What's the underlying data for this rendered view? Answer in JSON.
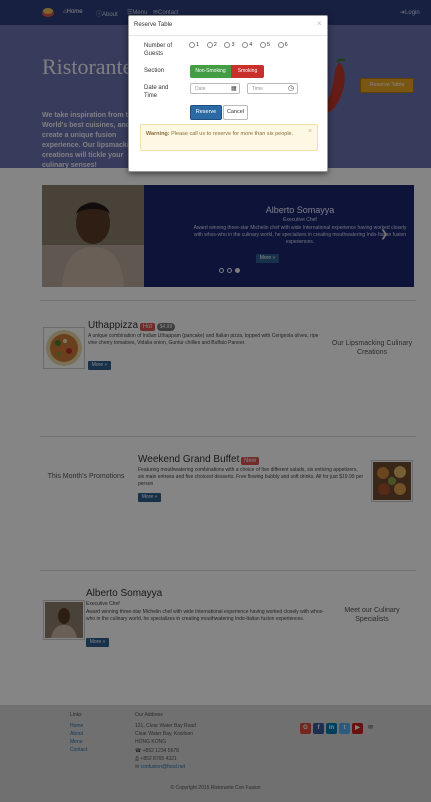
{
  "navbar": {
    "items": [
      {
        "label": "Home",
        "icon": "home-icon"
      },
      {
        "label": "About",
        "icon": "info-icon"
      },
      {
        "label": "Menu",
        "icon": "list-icon"
      },
      {
        "label": "Contact",
        "icon": "envelope-icon"
      }
    ],
    "login": "Login"
  },
  "jumbotron": {
    "title": "Ristorante Con Fusion",
    "description": "We take inspiration from the World's best cuisines, and create a unique fusion experience. Our lipsmacking creations will tickle your culinary senses!",
    "reserve_button": "Reserve Table"
  },
  "modal": {
    "title": "Reserve Table",
    "close": "×",
    "guests_label": "Number of Guests",
    "guest_options": [
      "1",
      "2",
      "3",
      "4",
      "5",
      "6"
    ],
    "section_label": "Section",
    "non_smoking": "Non-Smoking",
    "smoking": "Smoking",
    "datetime_label": "Date and Time",
    "date_placeholder": "Date",
    "time_placeholder": "Time",
    "reserve": "Reserve",
    "cancel": "Cancel",
    "warning_strong": "Warning:",
    "warning_text": "Please call us to reserve for more than six people.",
    "warning_close": "×"
  },
  "carousel": {
    "name": "Alberto Somayya",
    "role": "Executive Chef",
    "text": "Award winning three-star Michelin chef with wide International experience having worked closely with whos-who in the culinary world, he specializes in creating mouthwatering Indo-Italian fusion experiences.",
    "more": "More »"
  },
  "dish": {
    "name": "Uthappizza",
    "badge": "Hot",
    "price": "$4.99",
    "text": "A unique combination of Indian Uthappam (pancake) and Italian pizza, topped with Cerignola olives, ripe vine cherry tomatoes, Vidalia onion, Guntur chillies and Buffalo Paneer.",
    "more": "More »",
    "caption": "Our Lipsmacking Culinary Creations"
  },
  "promo": {
    "caption": "This Month's Promotions",
    "name": "Weekend Grand Buffet",
    "badge": "New",
    "text": "Featuring mouthwatering combinations with a choice of five different salads, six enticing appetizers, six main entrees and five choicest desserts. Free flowing bubbly and soft drinks. All for just $19.99 per person",
    "more": "More »"
  },
  "leader": {
    "name": "Alberto Somayya",
    "role": "Executive Chef",
    "text": "Award winning three-star Michelin chef with wide International experience having worked closely with whos-who in the culinary world, he specializes in creating mouthwatering Indo-Italian fusion experiences.",
    "more": "More »",
    "caption": "Meet our Culinary Specialists"
  },
  "footer": {
    "links_title": "Links",
    "links": [
      "Home",
      "About",
      "Menu",
      "Contact"
    ],
    "address_title": "Our Address",
    "address": [
      "121, Clear Water Bay Road",
      "Clear Water Bay, Kowloon",
      "HONG KONG"
    ],
    "phone": "+852 1234 5678",
    "fax": "+852 8765 4321",
    "email": "confusion@food.net",
    "copyright": "© Copyright 2015 Ristorante Con Fusion"
  },
  "colors": {
    "navbar": "#2c3f7e",
    "jumbotron": "#6a72b0",
    "accent": "#e8a623",
    "danger": "#d9534f",
    "success": "#449d44"
  }
}
